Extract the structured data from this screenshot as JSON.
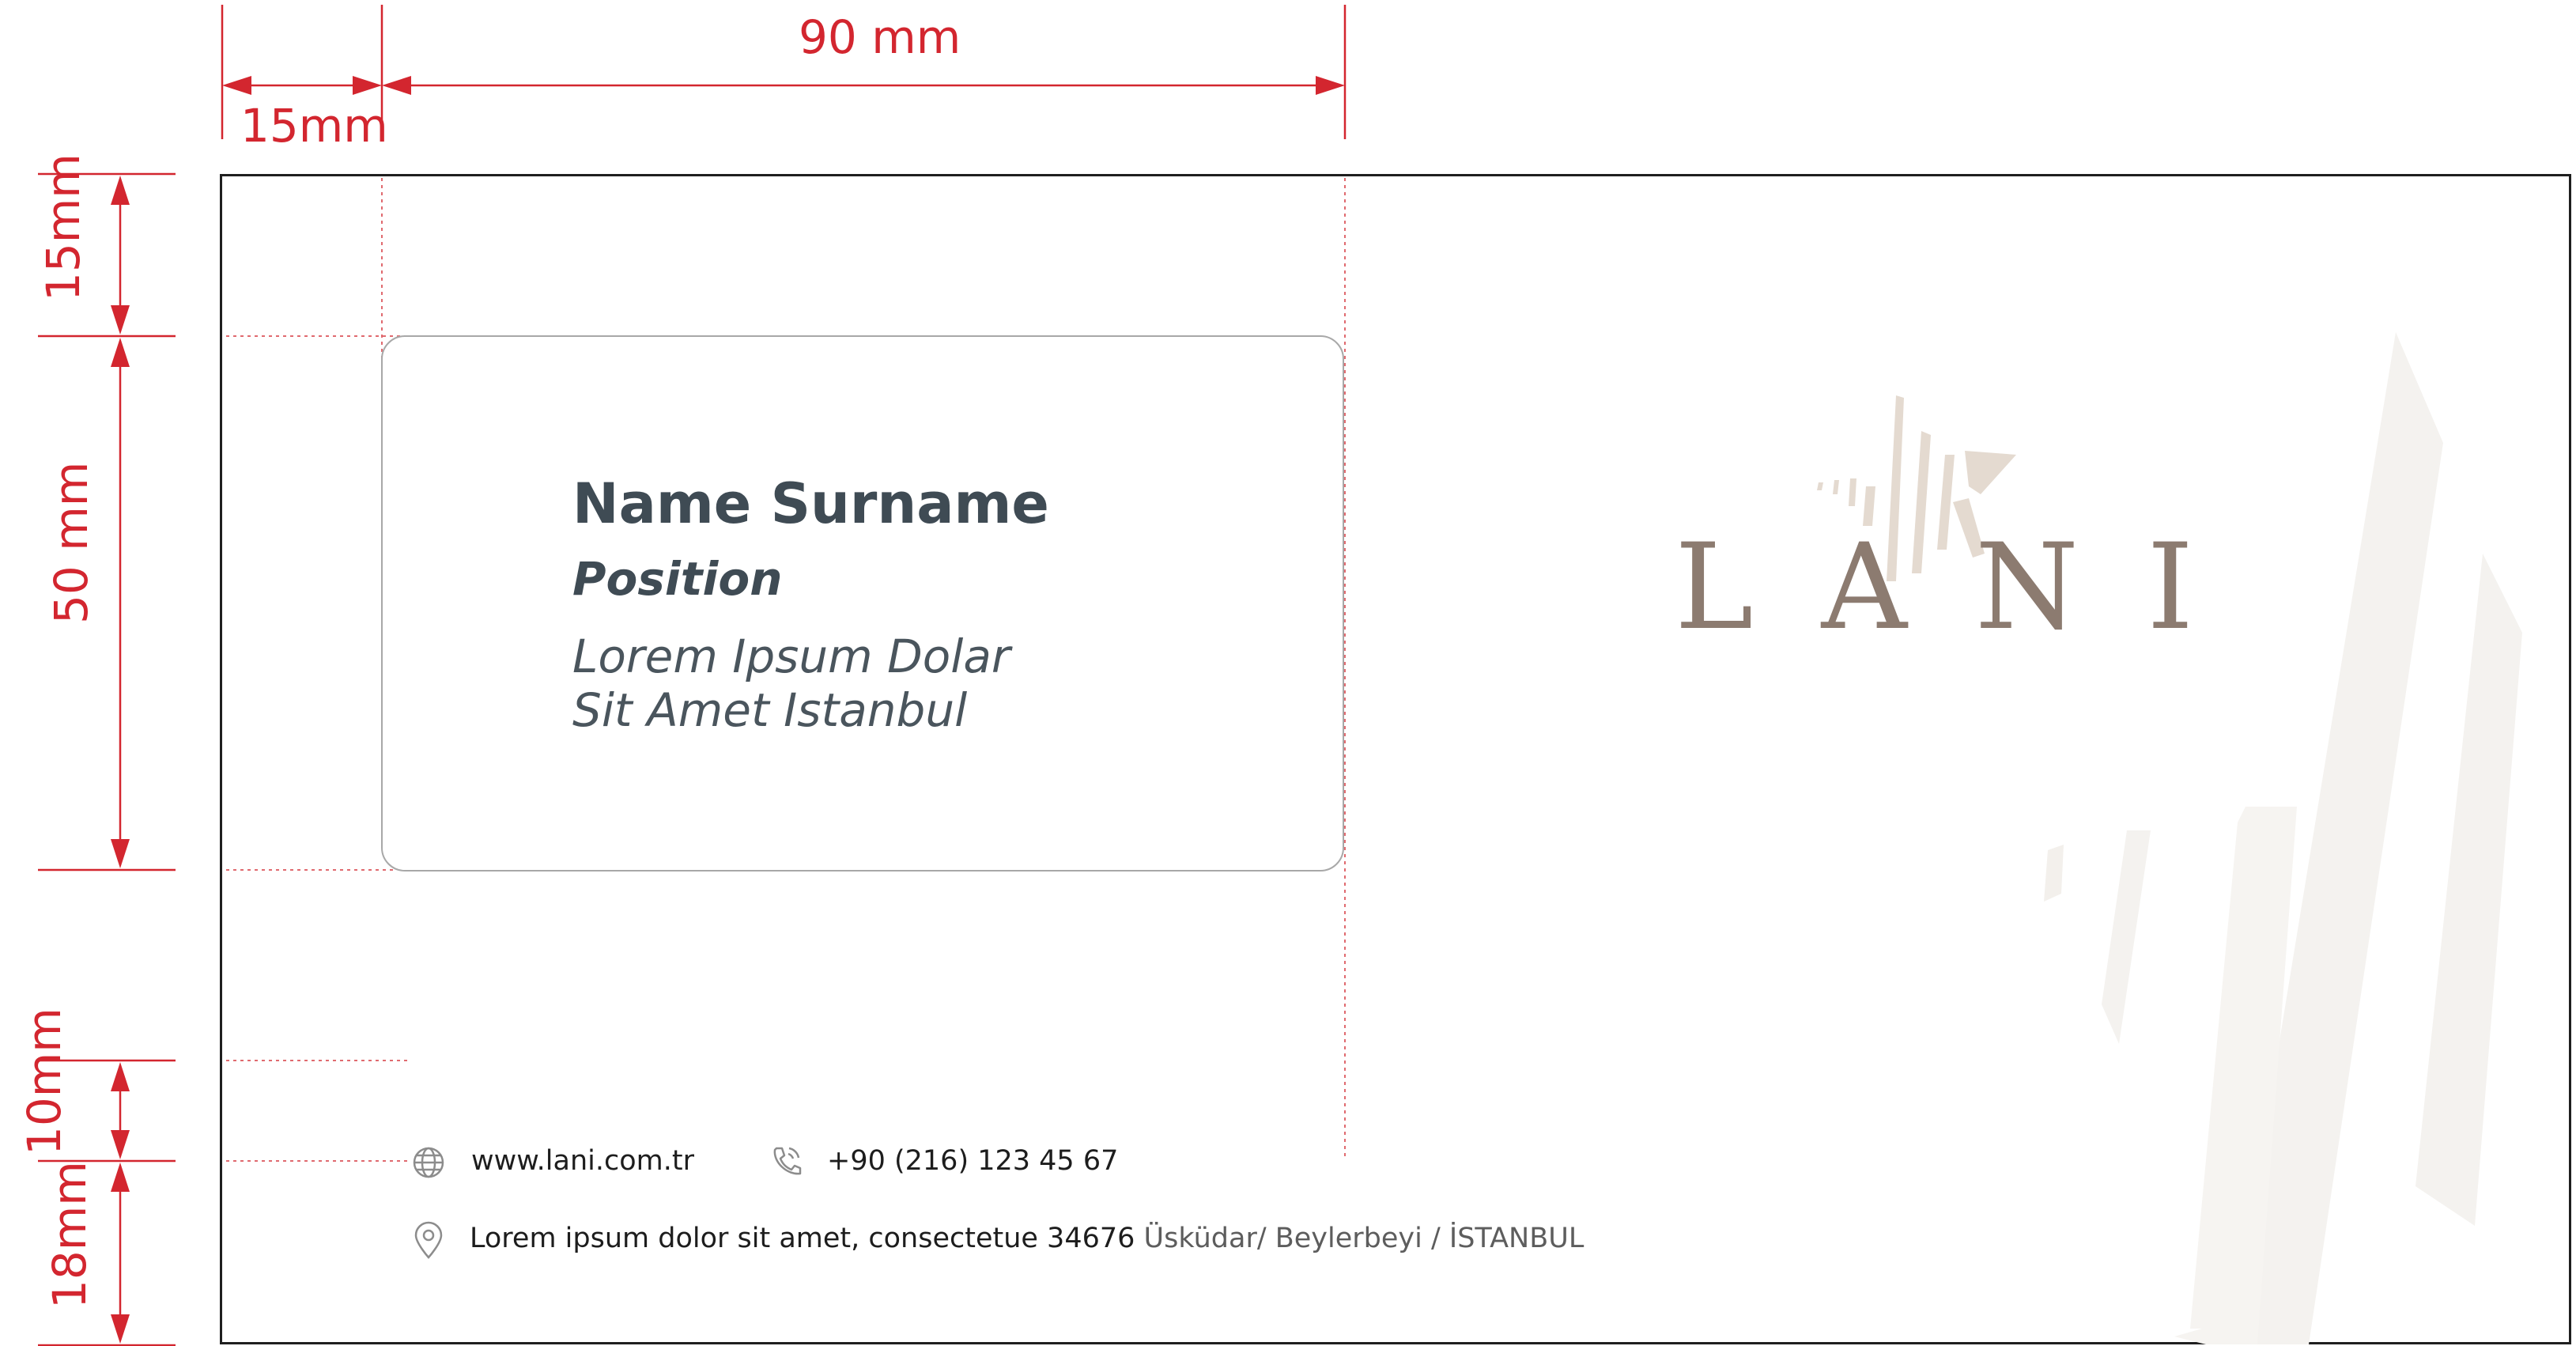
{
  "dimensions": {
    "top_90": "90 mm",
    "top_15": "15mm",
    "left_15": "15mm",
    "left_50": "50 mm",
    "left_10": "10mm",
    "left_18": "18mm"
  },
  "window": {
    "name": "Name Surname",
    "position": "Position",
    "address_line1": "Lorem Ipsum Dolar",
    "address_line2": "Sit Amet Istanbul"
  },
  "logo": {
    "text": "LANI"
  },
  "footer": {
    "website": "www.lani.com.tr",
    "phone": "+90 (216) 123 45 67",
    "address_main": "Lorem ipsum dolor sit amet, consectetue 34676",
    "address_area": "Üsküdar/ Beylerbeyi / İSTANBUL"
  },
  "icons": [
    "globe-icon",
    "phone-icon",
    "location-pin-icon"
  ],
  "colors": {
    "dimension": "#d3262f",
    "name_text": "#3f4b54",
    "logo": "#8c7b70",
    "logo_star": "#e4dad0",
    "decor": "#f4f2ef",
    "window_border": "#a8a8a8"
  }
}
